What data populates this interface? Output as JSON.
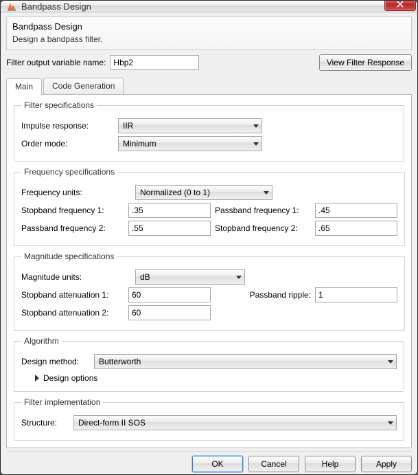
{
  "window": {
    "title": "Bandpass Design"
  },
  "header": {
    "title": "Bandpass Design",
    "subtitle": "Design a bandpass filter."
  },
  "filterVar": {
    "label": "Filter output variable name:",
    "value": "Hbp2"
  },
  "viewResponseBtn": "View Filter Response",
  "tabs": {
    "main": "Main",
    "code": "Code Generation"
  },
  "groups": {
    "filterSpec": "Filter specifications",
    "freqSpec": "Frequency specifications",
    "magSpec": "Magnitude specifications",
    "algo": "Algorithm",
    "impl": "Filter implementation"
  },
  "filterSpec": {
    "impulseLabel": "Impulse response:",
    "impulseValue": "IIR",
    "orderLabel": "Order mode:",
    "orderValue": "Minimum"
  },
  "freqSpec": {
    "unitsLabel": "Frequency units:",
    "unitsValue": "Normalized (0 to 1)",
    "fstop1Label": "Stopband frequency 1:",
    "fstop1": ".35",
    "fpass1Label": "Passband frequency 1:",
    "fpass1": ".45",
    "fpass2Label": "Passband frequency 2:",
    "fpass2": ".55",
    "fstop2Label": "Stopband frequency 2:",
    "fstop2": ".65"
  },
  "magSpec": {
    "unitsLabel": "Magnitude units:",
    "unitsValue": "dB",
    "astop1Label": "Stopband attenuation 1:",
    "astop1": "60",
    "apassLabel": "Passband ripple:",
    "apass": "1",
    "astop2Label": "Stopband attenuation 2:",
    "astop2": "60"
  },
  "algo": {
    "methodLabel": "Design method:",
    "methodValue": "Butterworth",
    "designOptions": "Design options"
  },
  "impl": {
    "structLabel": "Structure:",
    "structValue": "Direct-form II SOS"
  },
  "buttons": {
    "ok": "OK",
    "cancel": "Cancel",
    "help": "Help",
    "apply": "Apply"
  },
  "colors": {
    "accent": "#2b7bd1",
    "close": "#c93c3c"
  }
}
